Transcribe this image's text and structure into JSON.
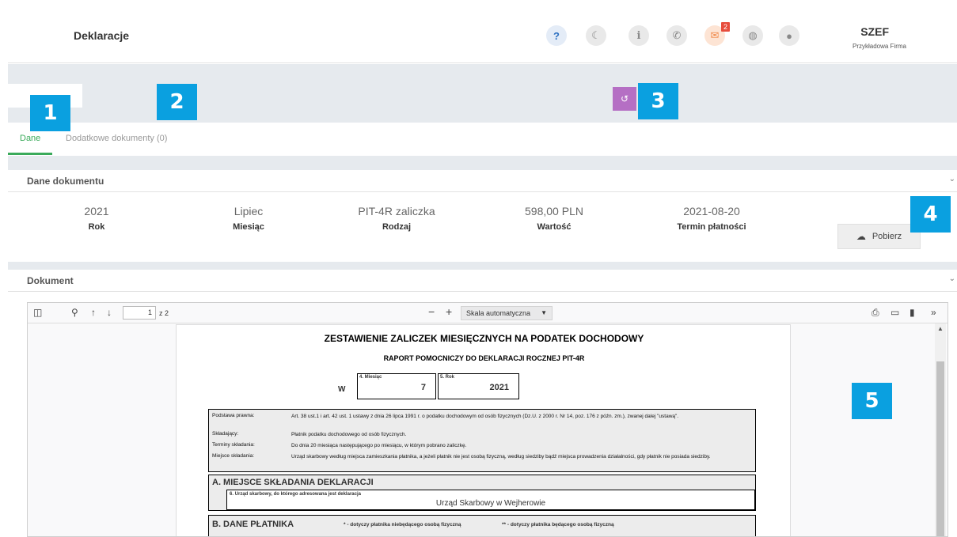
{
  "header": {
    "title": "Deklaracje",
    "mail_count": "2",
    "user_name": "SZEF",
    "company": "Przykładowa Firma",
    "icons": [
      "help-icon",
      "moon-icon",
      "info-icon",
      "phone-icon",
      "mail-icon",
      "globe-icon",
      "user-icon"
    ]
  },
  "markers": [
    "1",
    "2",
    "3",
    "4",
    "5"
  ],
  "tabs": [
    {
      "label": "Dane",
      "active": true
    },
    {
      "label": "Dodatkowe dokumenty (0)",
      "active": false
    }
  ],
  "document_data": {
    "section_title": "Dane dokumentu",
    "fields": [
      {
        "value": "2021",
        "label": "Rok"
      },
      {
        "value": "Lipiec",
        "label": "Miesiąc"
      },
      {
        "value": "PIT-4R zaliczka",
        "label": "Rodzaj"
      },
      {
        "value": "598,00 PLN",
        "label": "Wartość"
      },
      {
        "value": "2021-08-20",
        "label": "Termin płatności"
      }
    ],
    "download_label": "Pobierz"
  },
  "document": {
    "section_title": "Dokument",
    "viewer": {
      "current_page": "1",
      "page_of": "z 2",
      "zoom": "Skala automatyczna"
    },
    "pdf": {
      "title": "ZESTAWIENIE ZALICZEK MIESIĘCZNYCH NA PODATEK DOCHODOWY",
      "subtitle": "RAPORT POMOCNICZY DO DEKLARACJI ROCZNEJ  PIT-4R",
      "w_label": "W",
      "month_caption": "4. Miesiąc",
      "month_value": "7",
      "year_caption": "5. Rok",
      "year_value": "2021",
      "info": [
        {
          "key": "Podstawa prawna:",
          "text": "Art. 38 ust.1 i art. 42 ust. 1 ustawy z dnia 26 lipca 1991 r. o podatku dochodowym od osób fizycznych (Dz.U. z 2000 r. Nr 14, poz. 176 z późn. zm.), zwanej dalej \"ustawą\"."
        },
        {
          "key": "Składający:",
          "text": "Płatnik podatku dochodowego od osób fizycznych."
        },
        {
          "key": "Terminy składania:",
          "text": "Do dnia 20 miesiąca następującego po miesiącu, w którym pobrano zaliczkę."
        },
        {
          "key": "Miejsce składania:",
          "text": "Urząd skarbowy  według miejsca zamieszkania płatnika, a jeżeli płatnik nie jest osobą fizyczną, według siedziby bądź miejsca prowadzenia działalności, gdy płatnik nie posiada siedziby."
        }
      ],
      "section_a": "A. MIEJSCE SKŁADANIA DEKLARACJI",
      "office_caption": "6. Urząd skarbowy, do którego adresowana jest deklaracja",
      "office_value": "Urząd Skarbowy w Wejherowie",
      "section_b": "B. DANE PŁATNIKA",
      "note_1": "* - dotyczy płatnika niebędącego osobą fizyczną",
      "note_2": "** - dotyczy płatnika będącego osobą fizyczną"
    }
  },
  "colors": {
    "accent_green": "#3aaa5a",
    "marker_blue": "#0aa0e0",
    "purple": "#b56fc4",
    "badge_red": "#e74c3c"
  }
}
